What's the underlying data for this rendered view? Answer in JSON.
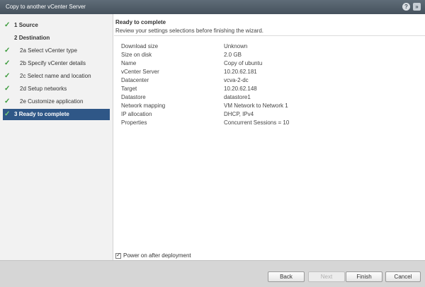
{
  "window": {
    "title": "Copy to another vCenter Server"
  },
  "steps": [
    {
      "num": "1",
      "label": "Source",
      "level": "main",
      "done": true
    },
    {
      "num": "2",
      "label": "Destination",
      "level": "main",
      "done": false
    },
    {
      "num": "2a",
      "label": "Select vCenter type",
      "level": "sub",
      "done": true
    },
    {
      "num": "2b",
      "label": "Specify vCenter details",
      "level": "sub",
      "done": true
    },
    {
      "num": "2c",
      "label": "Select name and location",
      "level": "sub",
      "done": true
    },
    {
      "num": "2d",
      "label": "Setup networks",
      "level": "sub",
      "done": true
    },
    {
      "num": "2e",
      "label": "Customize application",
      "level": "sub",
      "done": true
    },
    {
      "num": "3",
      "label": "Ready to complete",
      "level": "main",
      "done": true,
      "active": true
    }
  ],
  "page": {
    "heading": "Ready to complete",
    "subheading": "Review your settings selections before finishing the wizard."
  },
  "summary": [
    {
      "label": "Download size",
      "value": "Unknown"
    },
    {
      "label": "Size on disk",
      "value": "2.0 GB"
    },
    {
      "label": "Name",
      "value": "Copy of ubuntu"
    },
    {
      "label": "vCenter Server",
      "value": "10.20.62.181"
    },
    {
      "label": "Datacenter",
      "value": "vcva-2-dc"
    },
    {
      "label": "Target",
      "value": "10.20.62.148"
    },
    {
      "label": "Datastore",
      "value": "datastore1"
    },
    {
      "label": "Network mapping",
      "value": "VM Network to Network 1"
    },
    {
      "label": "IP allocation",
      "value": "DHCP, IPv4"
    },
    {
      "label": "Properties",
      "value": "Concurrent Sessions = 10"
    }
  ],
  "power_on": {
    "label": "Power on after deployment",
    "checked": true
  },
  "buttons": {
    "back": "Back",
    "next": "Next",
    "finish": "Finish",
    "cancel": "Cancel"
  }
}
